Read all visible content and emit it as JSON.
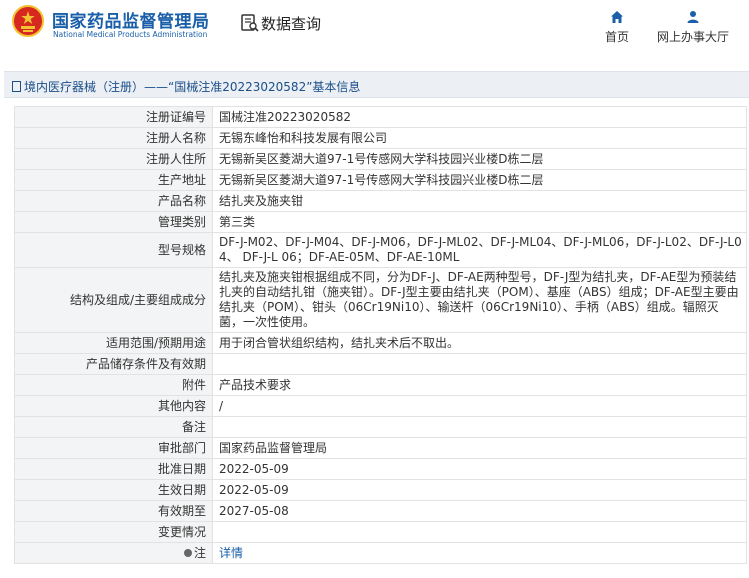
{
  "header": {
    "logo_cn": "国家药品监督管理局",
    "logo_en": "National Medical Products Administration",
    "db_title": "数据查询",
    "nav": [
      {
        "label": "首页",
        "icon": "home-icon"
      },
      {
        "label": "网上办事大厅",
        "icon": "user-icon"
      }
    ]
  },
  "breadcrumb": "境内医疗器械（注册）——“国械注准20223020582”基本信息",
  "rows": [
    {
      "label": "注册证编号",
      "value": "国械注准20223020582"
    },
    {
      "label": "注册人名称",
      "value": "无锡东峰怡和科技发展有限公司"
    },
    {
      "label": "注册人住所",
      "value": "无锡新吴区菱湖大道97-1号传感网大学科技园兴业楼D栋二层"
    },
    {
      "label": "生产地址",
      "value": "无锡新吴区菱湖大道97-1号传感网大学科技园兴业楼D栋二层"
    },
    {
      "label": "产品名称",
      "value": "结扎夹及施夹钳"
    },
    {
      "label": "管理类别",
      "value": "第三类"
    },
    {
      "label": "型号规格",
      "value": "DF-J-M02、DF-J-M04、DF-J-M06，DF-J-ML02、DF-J-ML04、DF-J-ML06，DF-J-L02、DF-J-L04、 DF-J-L 06；DF-AE-05M、DF-AE-10ML"
    },
    {
      "label": "结构及组成/主要组成成分",
      "value": "结扎夹及施夹钳根据组成不同，分为DF-J、DF-AE两种型号，DF-J型为结扎夹，DF-AE型为预装结扎夹的自动结扎钳（施夹钳）。DF-J型主要由结扎夹（POM）、基座（ABS）组成；DF-AE型主要由结扎夹（POM）、钳头（06Cr19Ni10）、输送杆（06Cr19Ni10）、手柄（ABS）组成。辐照灭菌，一次性使用。"
    },
    {
      "label": "适用范围/预期用途",
      "value": "用于闭合管状组织结构，结扎夹术后不取出。"
    },
    {
      "label": "产品储存条件及有效期",
      "value": ""
    },
    {
      "label": "附件",
      "value": "产品技术要求"
    },
    {
      "label": "其他内容",
      "value": "/"
    },
    {
      "label": "备注",
      "value": ""
    },
    {
      "label": "审批部门",
      "value": "国家药品监督管理局"
    },
    {
      "label": "批准日期",
      "value": "2022-05-09"
    },
    {
      "label": "生效日期",
      "value": "2022-05-09"
    },
    {
      "label": "有效期至",
      "value": "2027-05-08"
    },
    {
      "label": "变更情况",
      "value": ""
    },
    {
      "label": "注",
      "value": "详情"
    }
  ],
  "colors": {
    "brand_blue": "#1a5fa8",
    "emblem_red": "#d6281f",
    "emblem_gold": "#f2c230"
  }
}
